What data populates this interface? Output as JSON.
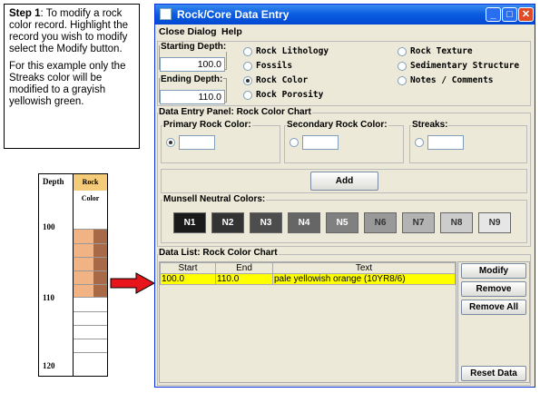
{
  "instructions": {
    "step_label": "Step 1",
    "step_text": ": To modify a rock color record.  Highlight the record you wish to modify select the Modify button.",
    "note": "For this example only the Streaks color will be modified to a grayish yellowish green."
  },
  "strip_log": {
    "depth_header": "Depth",
    "column_header": "Rock Color",
    "depths": [
      "100",
      "110",
      "120"
    ],
    "colors": {
      "swatch": "#f2b384",
      "edge": "#a86a46",
      "header": "#f4cc79"
    }
  },
  "window": {
    "title": "Rock/Core Data Entry",
    "menu": [
      "Close Dialog",
      "Help"
    ],
    "starting_depth_label": "Starting Depth:",
    "starting_depth_value": "100.0",
    "ending_depth_label": "Ending Depth:",
    "ending_depth_value": "110.0",
    "options": [
      "Rock Lithology",
      "Fossils",
      "Rock Color",
      "Rock Porosity",
      "Rock Texture",
      "Sedimentary Structure",
      "Notes / Comments"
    ],
    "selected_option": "Rock Color",
    "entry_panel_title": "Data Entry Panel: Rock Color Chart",
    "primary_label": "Primary Rock Color:",
    "secondary_label": "Secondary Rock Color:",
    "streaks_label": "Streaks:",
    "add_label": "Add",
    "munsell_title": "Munsell Neutral Colors:",
    "munsell": [
      {
        "label": "N1",
        "bg": "#1a1a1a",
        "fg": "#ffffff"
      },
      {
        "label": "N2",
        "bg": "#333333",
        "fg": "#ffffff"
      },
      {
        "label": "N3",
        "bg": "#4d4d4d",
        "fg": "#ffffff"
      },
      {
        "label": "N4",
        "bg": "#666666",
        "fg": "#ffffff"
      },
      {
        "label": "N5",
        "bg": "#808080",
        "fg": "#ffffff"
      },
      {
        "label": "N6",
        "bg": "#999999",
        "fg": "#333333"
      },
      {
        "label": "N7",
        "bg": "#b3b3b3",
        "fg": "#333333"
      },
      {
        "label": "N8",
        "bg": "#cccccc",
        "fg": "#333333"
      },
      {
        "label": "N9",
        "bg": "#e6e6e6",
        "fg": "#333333"
      }
    ],
    "list_title": "Data List: Rock Color Chart",
    "columns": [
      "Start",
      "End",
      "Text"
    ],
    "rows": [
      {
        "start": "100.0",
        "end": "110.0",
        "text": "pale yellowish orange (10YR8/6)"
      }
    ],
    "buttons": {
      "modify": "Modify",
      "remove": "Remove",
      "remove_all": "Remove All",
      "reset": "Reset Data"
    }
  },
  "arrow_color": "#e8141b"
}
